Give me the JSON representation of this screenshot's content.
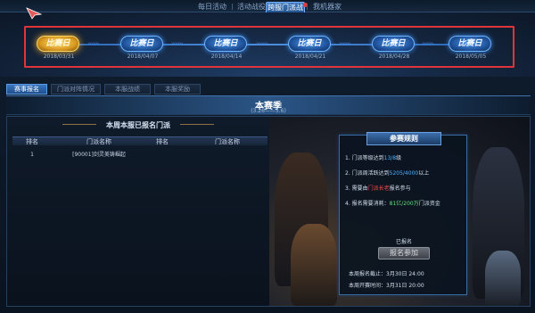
{
  "top_nav": {
    "tabs": [
      {
        "label": "每日活动"
      },
      {
        "label": "活动战役"
      },
      {
        "label": "跨服门派战"
      },
      {
        "label": "我机器家"
      }
    ]
  },
  "schedule": {
    "nodes": [
      {
        "label": "比赛日",
        "date": "2018/03/31",
        "state": "current"
      },
      {
        "label": "比赛日",
        "date": "2018/04/07",
        "state": "upcoming"
      },
      {
        "label": "比赛日",
        "date": "2018/04/14",
        "state": "upcoming"
      },
      {
        "label": "比赛日",
        "date": "2018/04/21",
        "state": "upcoming"
      },
      {
        "label": "比赛日",
        "date": "2018/04/28",
        "state": "upcoming"
      },
      {
        "label": "比赛日",
        "date": "2018/05/05",
        "state": "upcoming"
      }
    ],
    "highlight_color": "#e0333a"
  },
  "sub_tabs": [
    {
      "label": "赛事报名"
    },
    {
      "label": "门派对阵情况"
    },
    {
      "label": "本服战绩"
    },
    {
      "label": "本服奖励"
    }
  ],
  "season": {
    "title": "本赛季",
    "range": "(3.26——5.6)"
  },
  "registered_panel": {
    "title": "本周本服已报名门派",
    "headers": [
      "排名",
      "门派名称",
      "排名",
      "门派名称"
    ],
    "rows": [
      {
        "rank": "1",
        "name": "[90001]剑灵美铸崛起"
      }
    ]
  },
  "rules_panel": {
    "title": "参赛规则",
    "rules": [
      {
        "prefix": "1. 门派等级达到",
        "highlight": "13/8",
        "suffix": "级"
      },
      {
        "prefix": "2. 门派周活跃达到",
        "highlight": "5205/4000",
        "suffix": "以上"
      },
      {
        "prefix": "3. 需要由",
        "highlight": "门派长老",
        "suffix": "报名参与"
      },
      {
        "prefix": "4. 报名需要消耗：",
        "highlight": "81亿/200万",
        "suffix": "门派资金"
      }
    ],
    "status": "已报名",
    "button_label": "报名参加",
    "deadline": "本周报名截止：3月30日  24:00",
    "match_time": "本周开赛时间：3月31日  20:00"
  }
}
